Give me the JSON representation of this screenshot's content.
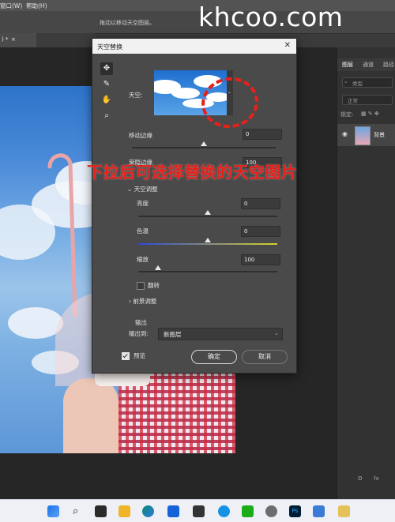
{
  "menubar": {
    "items": [
      "窗口(W)",
      "帮助(H)"
    ]
  },
  "options_bar": {
    "hint": "拖动以移动天空图层。"
  },
  "watermark": "khcoo.com",
  "doc_tab": {
    "title": ") *",
    "close": "×"
  },
  "right_panel": {
    "tabs": [
      "图层",
      "通道",
      "路径"
    ],
    "search_placeholder": "类型",
    "blend_mode": "正常",
    "lock_label": "锁定:",
    "layer_name": "背景",
    "bottom_icons": [
      "ʘ",
      "fx"
    ]
  },
  "dialog": {
    "title": "天空替换",
    "sky_label": "天空:",
    "move_edge": {
      "label": "移动边缘",
      "value": "0",
      "level": 0.5
    },
    "fade_edge": {
      "label": "渐隐边缘",
      "value": "100"
    },
    "sky_adjust_label": "天空调整",
    "brightness": {
      "label": "亮度",
      "value": "0",
      "level": 0.5
    },
    "temperature": {
      "label": "色温",
      "value": "0",
      "level": 0.5
    },
    "scale": {
      "label": "缩放",
      "value": "100",
      "level": 0.14
    },
    "flip_label": "翻转",
    "foreground_label": "前景调整",
    "output_section": "输出",
    "output_to_label": "输出到:",
    "output_to_value": "新图层",
    "preview_label": "预览",
    "ok_label": "确定",
    "cancel_label": "取消"
  },
  "annotation": "下拉后可选择替换的天空图片",
  "colors": {
    "annotation_red": "#e8201a",
    "dialog_bg": "#4a4a4a",
    "panel_bg": "#323232"
  }
}
